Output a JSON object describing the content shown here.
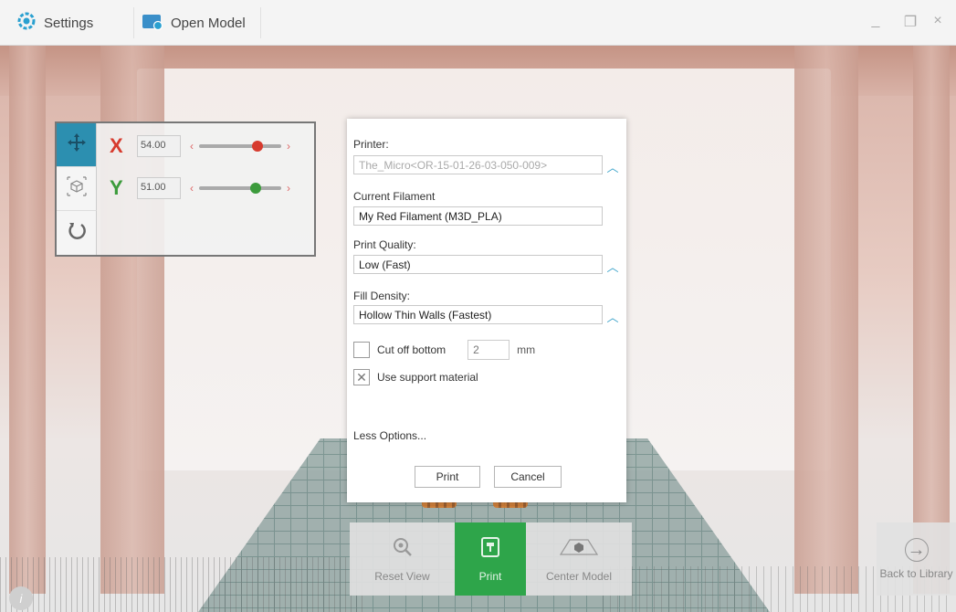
{
  "titlebar": {
    "settings_label": "Settings",
    "open_model_label": "Open Model",
    "minimize_icon": "_",
    "restore_icon": "❐",
    "close_icon": "×"
  },
  "transform": {
    "x_label": "X",
    "x_value": "54.00",
    "y_label": "Y",
    "y_value": "51.00",
    "x_color": "#d73b2e",
    "y_color": "#3c9b3c"
  },
  "dialog": {
    "printer_label": "Printer:",
    "printer_value": "The_Micro<OR-15-01-26-03-050-009>",
    "filament_label": "Current Filament",
    "filament_value": "My Red Filament (M3D_PLA)",
    "quality_label": "Print Quality:",
    "quality_value": "Low (Fast)",
    "density_label": "Fill Density:",
    "density_value": "Hollow Thin Walls (Fastest)",
    "cut_off_label": "Cut off bottom",
    "cut_off_value": "2",
    "cut_off_unit": "mm",
    "cut_off_checked": false,
    "support_label": "Use support material",
    "support_checked": true,
    "less_options": "Less Options...",
    "print_button": "Print",
    "cancel_button": "Cancel"
  },
  "bottom_toolbar": {
    "reset_view": "Reset View",
    "print": "Print",
    "center_model": "Center Model",
    "back_to_library": "Back to Library"
  },
  "colors": {
    "accent_blue": "#35a0c8",
    "print_green": "#2ea54a"
  }
}
